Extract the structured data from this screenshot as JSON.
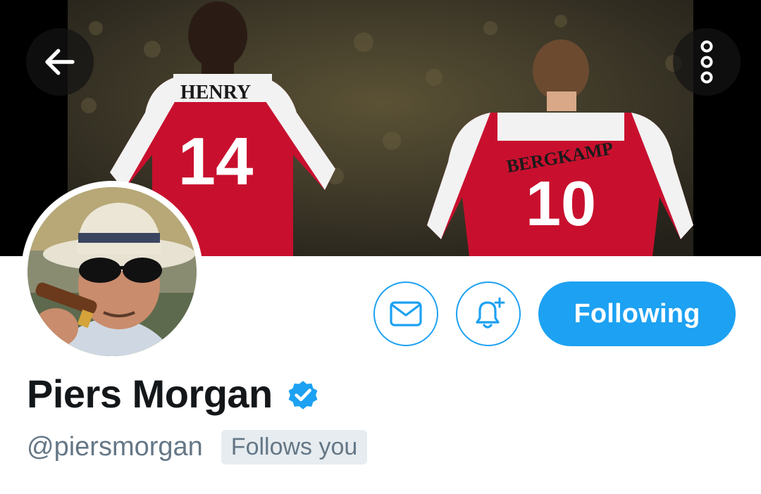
{
  "header": {
    "back_icon": "arrow-left-icon",
    "more_icon": "more-vertical-icon",
    "banner": {
      "description_icon": "banner-photo",
      "player_left": {
        "name": "HENRY",
        "number": "14"
      },
      "player_right": {
        "name": "BERGKAMP",
        "number": "10"
      }
    }
  },
  "profile": {
    "display_name": "Piers Morgan",
    "handle": "@piersmorgan",
    "follows_you_label": "Follows you",
    "verified_icon": "verified-badge-icon"
  },
  "actions": {
    "message_icon": "envelope-icon",
    "notify_icon": "bell-plus-icon",
    "following_label": "Following"
  },
  "colors": {
    "accent": "#1da1f2",
    "text_primary": "#14171a",
    "text_secondary": "#657786",
    "badge_bg": "#e6ecf0",
    "jersey_red": "#c8102e"
  }
}
